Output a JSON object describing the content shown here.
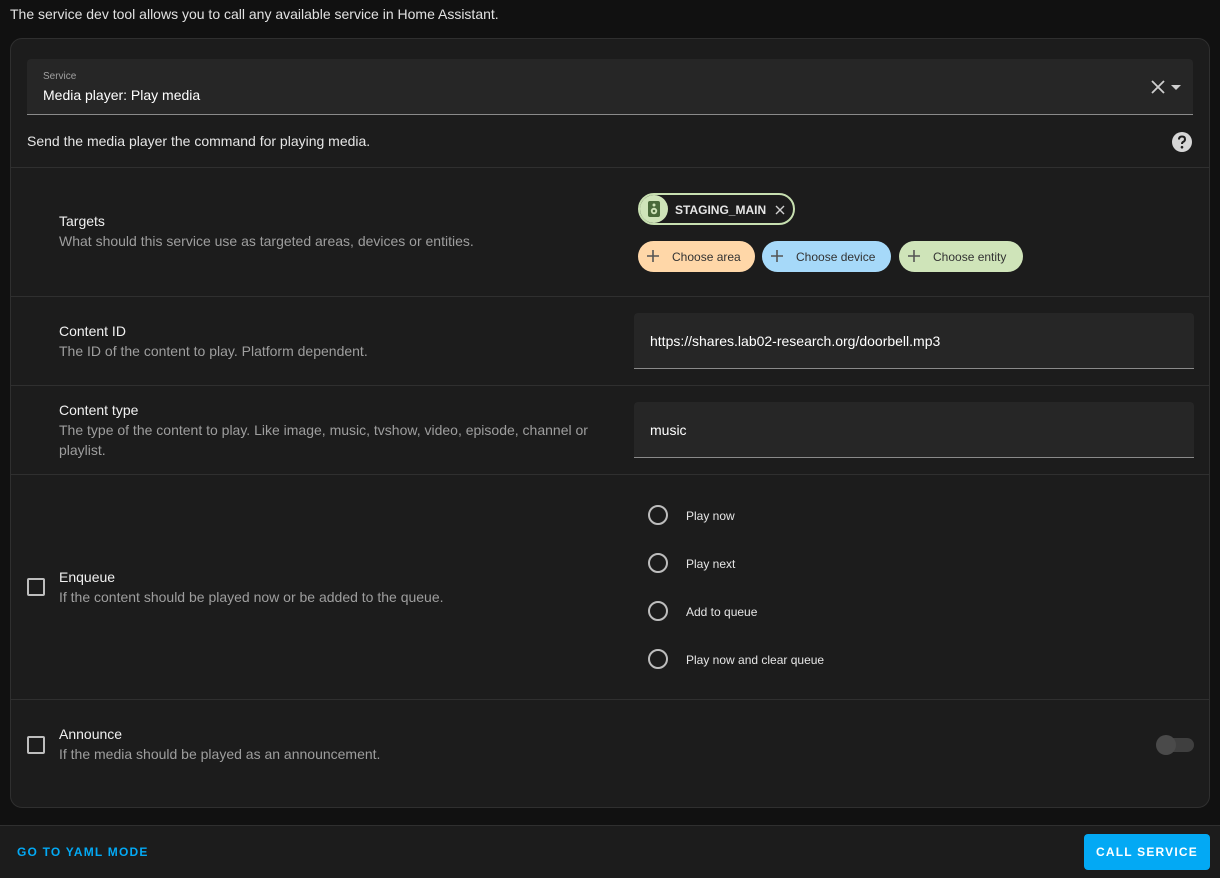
{
  "intro_text": "The service dev tool allows you to call any available service in Home Assistant.",
  "service": {
    "label": "Service",
    "value": "Media player: Play media",
    "description": "Send the media player the command for playing media."
  },
  "targets": {
    "title": "Targets",
    "subtitle": "What should this service use as targeted areas, devices or entities.",
    "selected_entity": "STAGING_MAIN",
    "add_area": "Choose area",
    "add_device": "Choose device",
    "add_entity": "Choose entity"
  },
  "content_id": {
    "title": "Content ID",
    "subtitle": "The ID of the content to play. Platform dependent.",
    "value": "https://shares.lab02-research.org/doorbell.mp3"
  },
  "content_type": {
    "title": "Content type",
    "subtitle": "The type of the content to play. Like image, music, tvshow, video, episode, channel or playlist.",
    "value": "music"
  },
  "enqueue": {
    "title": "Enqueue",
    "subtitle": "If the content should be played now or be added to the queue.",
    "options": [
      "Play now",
      "Play next",
      "Add to queue",
      "Play now and clear queue"
    ]
  },
  "announce": {
    "title": "Announce",
    "subtitle": "If the media should be played as an announcement."
  },
  "footer": {
    "yaml_mode": "GO TO YAML MODE",
    "call_service": "CALL SERVICE"
  },
  "colors": {
    "accent": "#03a9f4",
    "area_chip": "#ffd7a8",
    "device_chip": "#a6d9f9",
    "entity_chip": "#cfe4b9"
  }
}
